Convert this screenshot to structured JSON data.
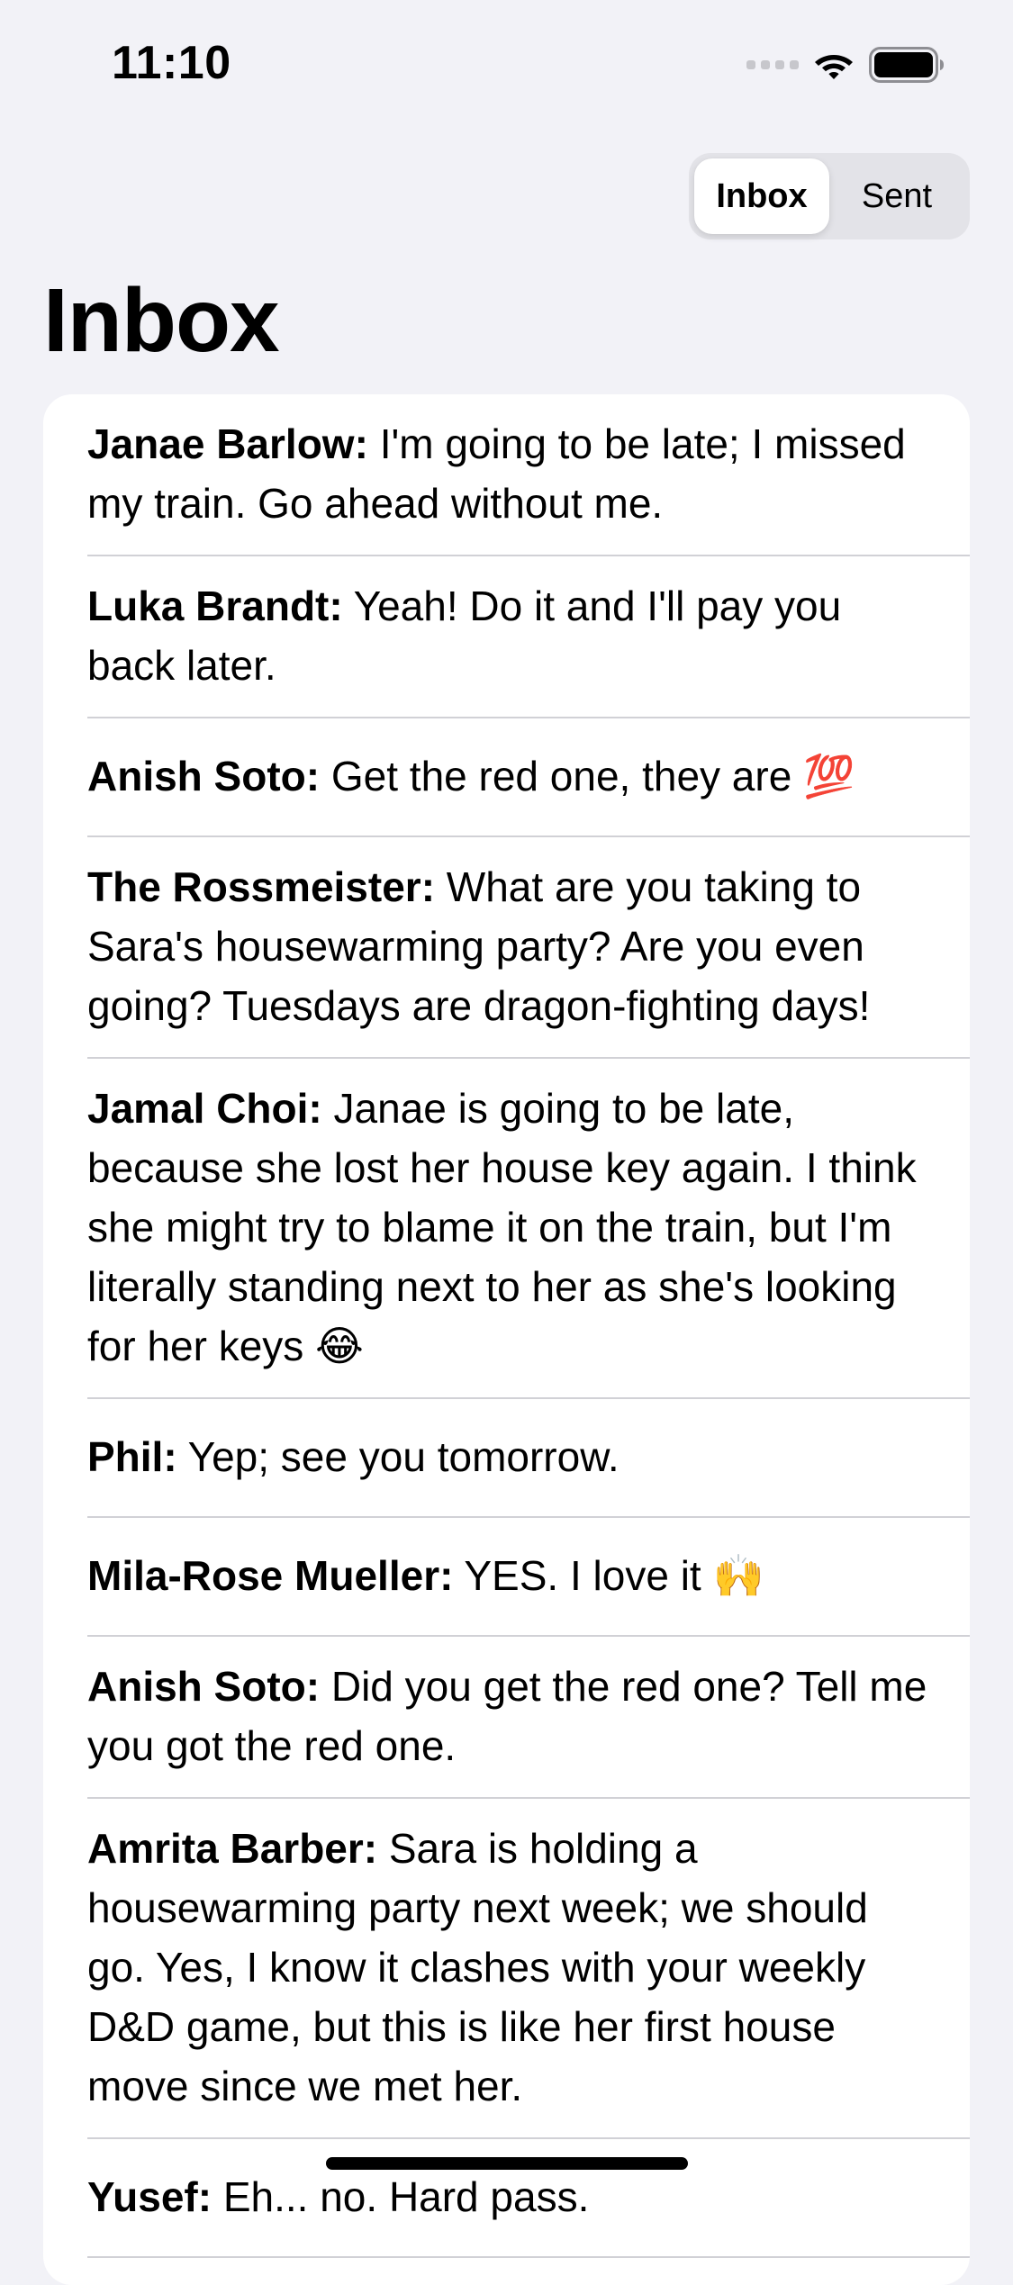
{
  "status_bar": {
    "time": "11:10"
  },
  "segmented_control": {
    "options": [
      "Inbox",
      "Sent"
    ],
    "selected": "Inbox"
  },
  "title": "Inbox",
  "messages": [
    {
      "sender": "Janae Barlow:",
      "text": "I'm going to be late; I missed my train. Go ahead without me."
    },
    {
      "sender": "Luka Brandt:",
      "text": "Yeah! Do it and I'll pay you back later."
    },
    {
      "sender": "Anish Soto:",
      "text": "Get the red one, they are 💯"
    },
    {
      "sender": "The Rossmeister:",
      "text": "What are you taking to Sara's housewarming party? Are you even going? Tuesdays are dragon-fighting days!"
    },
    {
      "sender": "Jamal Choi:",
      "text": "Janae is going to be late, because she lost her house key again. I think she might try to blame it on the train, but I'm literally standing next to her as she's looking for her keys 😂"
    },
    {
      "sender": "Phil:",
      "text": "Yep; see you tomorrow."
    },
    {
      "sender": "Mila-Rose Mueller:",
      "text": "YES. I love it 🙌"
    },
    {
      "sender": "Anish Soto:",
      "text": "Did you get the red one? Tell me you got the red one."
    },
    {
      "sender": "Amrita Barber:",
      "text": "Sara is holding a housewarming party next week; we should go. Yes, I know it clashes with your weekly D&D game, but this is like her first house move since we met her."
    },
    {
      "sender": "Yusef:",
      "text": "Eh... no. Hard pass."
    }
  ]
}
